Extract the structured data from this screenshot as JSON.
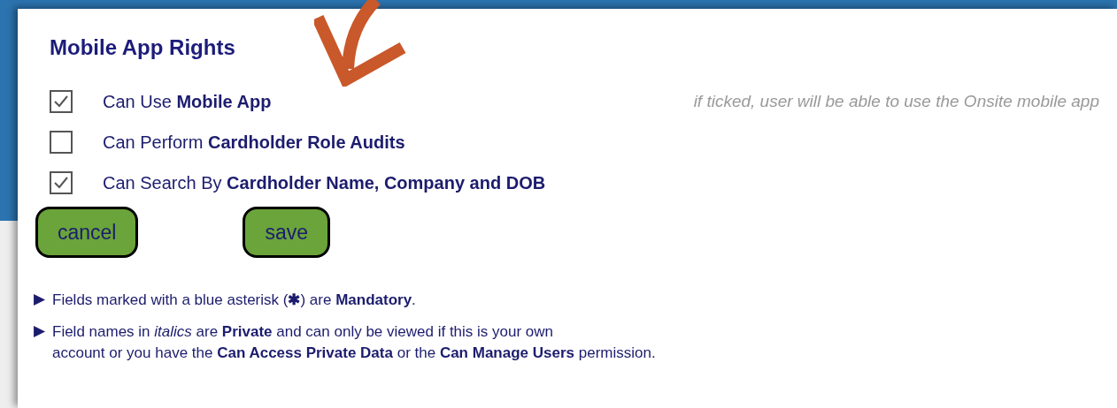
{
  "section": {
    "title": "Mobile App Rights"
  },
  "rights": [
    {
      "label": "Can Use **Mobile App**",
      "checked": true,
      "hint": "if ticked, user will be able to use the Onsite mobile app"
    },
    {
      "label": "Can Perform **Cardholder Role Audits**",
      "checked": false
    },
    {
      "label": "Can Search By **Cardholder Name, Company and DOB**",
      "checked": true
    }
  ],
  "buttons": [
    "cancel",
    "save"
  ],
  "notes": [
    {
      "marker": "▶",
      "text": "Fields marked with a blue asterisk (**✱**) are **Mandatory**."
    },
    {
      "marker": "▶",
      "text": "Field names in *italics* are **Private** and can only be viewed if this is your own\naccount or you have the **Can Access Private Data** or the **Can Manage Users** permission."
    }
  ]
}
